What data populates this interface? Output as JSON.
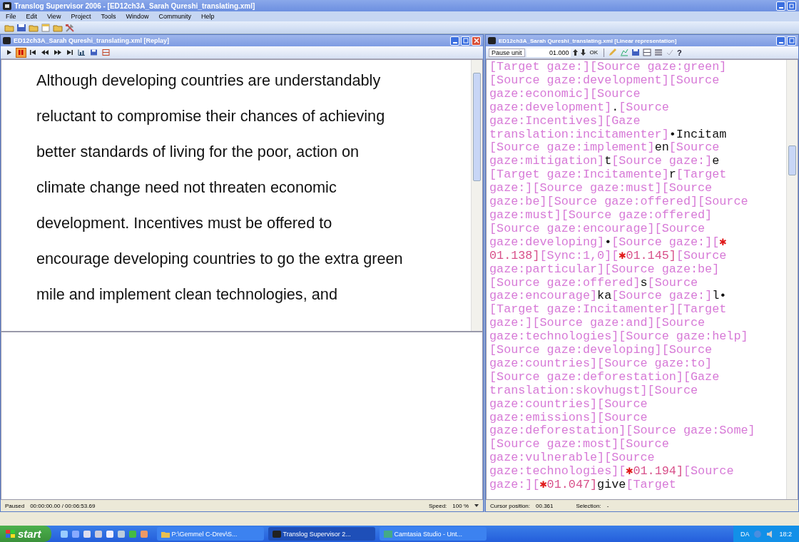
{
  "window": {
    "title": "Translog Supervisor 2006 - [ED12ch3A_Sarah Qureshi_translating.xml]"
  },
  "menu": [
    "File",
    "Edit",
    "View",
    "Project",
    "Tools",
    "Window",
    "Community",
    "Help"
  ],
  "toolbar": [
    {
      "kind": "open"
    },
    {
      "kind": "save"
    },
    {
      "kind": "folder"
    },
    {
      "kind": "new"
    },
    {
      "kind": "open"
    },
    {
      "kind": "tools"
    }
  ],
  "replay_window": {
    "title": "ED12ch3A_Sarah Qureshi_translating.xml [Replay]",
    "controls": [
      {
        "kind": "play",
        "selected": false
      },
      {
        "kind": "pause",
        "selected": true
      },
      {
        "kind": "start",
        "selected": false
      },
      {
        "kind": "rewind",
        "selected": false
      },
      {
        "kind": "forward",
        "selected": false
      },
      {
        "kind": "end",
        "selected": false
      },
      {
        "kind": "chart",
        "selected": false
      },
      {
        "kind": "save",
        "selected": false
      },
      {
        "kind": "split",
        "selected": false
      }
    ],
    "text": "Although developing countries are understandably reluctant to compromise their chances of achieving better standards of living for the poor, action on climate change need not threaten economic development. Incentives must be offered to encourage developing countries to go the extra green mile and implement clean technologies, and",
    "status": {
      "state": "Paused",
      "time": "00:00:00.00 / 00:06:53.69",
      "speed_label": "Speed:",
      "speed": "100 %"
    }
  },
  "linear_window": {
    "title": "ED12ch3A_Sarah Qureshi_translating.xml [Linear representation]",
    "pause_unit": {
      "label": "Pause unit",
      "value": "01.000"
    },
    "ok": "OK",
    "help": "?",
    "lines": [
      [
        {
          "kind": "gaze",
          "text": "[Target gaze:][Source gaze:green]"
        }
      ],
      [
        {
          "kind": "gaze",
          "text": "[Source gaze:development][Source"
        }
      ],
      [
        {
          "kind": "gaze",
          "text": "gaze:economic][Source"
        }
      ],
      [
        {
          "kind": "gaze",
          "text": "gaze:development]"
        },
        {
          "kind": "typed",
          "text": "."
        },
        {
          "kind": "gaze",
          "text": "[Source"
        }
      ],
      [
        {
          "kind": "gaze",
          "text": "gaze:Incentives][Gaze"
        }
      ],
      [
        {
          "kind": "gaze",
          "text": "translation:incitamenter]"
        },
        {
          "kind": "typed",
          "text": "•Incitam"
        }
      ],
      [
        {
          "kind": "gaze",
          "text": "[Source gaze:implement]"
        },
        {
          "kind": "typed",
          "text": "en"
        },
        {
          "kind": "gaze",
          "text": "[Source"
        }
      ],
      [
        {
          "kind": "gaze",
          "text": "gaze:mitigation]"
        },
        {
          "kind": "typed",
          "text": "t"
        },
        {
          "kind": "gaze",
          "text": "[Source gaze:]"
        },
        {
          "kind": "typed",
          "text": "e"
        }
      ],
      [
        {
          "kind": "gaze",
          "text": "[Target gaze:Incitamente]"
        },
        {
          "kind": "typed",
          "text": "r"
        },
        {
          "kind": "gaze",
          "text": "[Target"
        }
      ],
      [
        {
          "kind": "gaze",
          "text": "gaze:][Source gaze:must][Source"
        }
      ],
      [
        {
          "kind": "gaze",
          "text": "gaze:be][Source gaze:offered][Source"
        }
      ],
      [
        {
          "kind": "gaze",
          "text": "gaze:must][Source gaze:offered]"
        }
      ],
      [
        {
          "kind": "gaze",
          "text": "[Source gaze:encourage][Source"
        }
      ],
      [
        {
          "kind": "gaze",
          "text": "gaze:developing]"
        },
        {
          "kind": "typed",
          "text": "•"
        },
        {
          "kind": "gaze",
          "text": "[Source gaze:]["
        },
        {
          "kind": "star",
          "text": "✱"
        }
      ],
      [
        {
          "kind": "pause",
          "text": "01.138]"
        },
        {
          "kind": "gaze",
          "text": "[Sync:1,0]["
        },
        {
          "kind": "star",
          "text": "✱"
        },
        {
          "kind": "pause",
          "text": "01.145]"
        },
        {
          "kind": "gaze",
          "text": "[Source"
        }
      ],
      [
        {
          "kind": "gaze",
          "text": "gaze:particular][Source gaze:be]"
        }
      ],
      [
        {
          "kind": "gaze",
          "text": "[Source gaze:offered]"
        },
        {
          "kind": "typed",
          "text": "s"
        },
        {
          "kind": "gaze",
          "text": "[Source"
        }
      ],
      [
        {
          "kind": "gaze",
          "text": "gaze:encourage]"
        },
        {
          "kind": "typed",
          "text": "ka"
        },
        {
          "kind": "gaze",
          "text": "[Source gaze:]"
        },
        {
          "kind": "typed",
          "text": "l•"
        }
      ],
      [
        {
          "kind": "gaze",
          "text": "[Target gaze:Incitamenter][Target"
        }
      ],
      [
        {
          "kind": "gaze",
          "text": "gaze:][Source gaze:and][Source"
        }
      ],
      [
        {
          "kind": "gaze",
          "text": "gaze:technologies][Source gaze:help]"
        }
      ],
      [
        {
          "kind": "gaze",
          "text": "[Source gaze:developing][Source"
        }
      ],
      [
        {
          "kind": "gaze",
          "text": "gaze:countries][Source gaze:to]"
        }
      ],
      [
        {
          "kind": "gaze",
          "text": "[Source gaze:deforestation][Gaze"
        }
      ],
      [
        {
          "kind": "gaze",
          "text": "translation:skovhugst][Source"
        }
      ],
      [
        {
          "kind": "gaze",
          "text": "gaze:countries][Source"
        }
      ],
      [
        {
          "kind": "gaze",
          "text": "gaze:emissions][Source"
        }
      ],
      [
        {
          "kind": "gaze",
          "text": "gaze:deforestation][Source gaze:Some]"
        }
      ],
      [
        {
          "kind": "gaze",
          "text": "[Source gaze:most][Source"
        }
      ],
      [
        {
          "kind": "gaze",
          "text": "gaze:vulnerable][Source"
        }
      ],
      [
        {
          "kind": "gaze",
          "text": "gaze:technologies]["
        },
        {
          "kind": "star",
          "text": "✱"
        },
        {
          "kind": "pause",
          "text": "01.194]"
        },
        {
          "kind": "gaze",
          "text": "[Source"
        }
      ],
      [
        {
          "kind": "gaze",
          "text": "gaze:]["
        },
        {
          "kind": "star",
          "text": "✱"
        },
        {
          "kind": "pause",
          "text": "01.047]"
        },
        {
          "kind": "typed",
          "text": "give"
        },
        {
          "kind": "gaze",
          "text": "[Target"
        }
      ]
    ],
    "status": {
      "cursor_label": "Cursor position:",
      "cursor": "00.361",
      "selection_label": "Selection:",
      "selection": "-"
    }
  },
  "taskbar": {
    "start": "start",
    "tasks": [
      {
        "label": "P:\\Gemmel C-Drev\\S...",
        "kind": "folder",
        "selected": false
      },
      {
        "label": "Translog Supervisor 2...",
        "kind": "app",
        "selected": true
      },
      {
        "label": "Camtasia Studio - Unt...",
        "kind": "studio",
        "selected": false
      }
    ],
    "language": "DA",
    "time": "18:2"
  }
}
